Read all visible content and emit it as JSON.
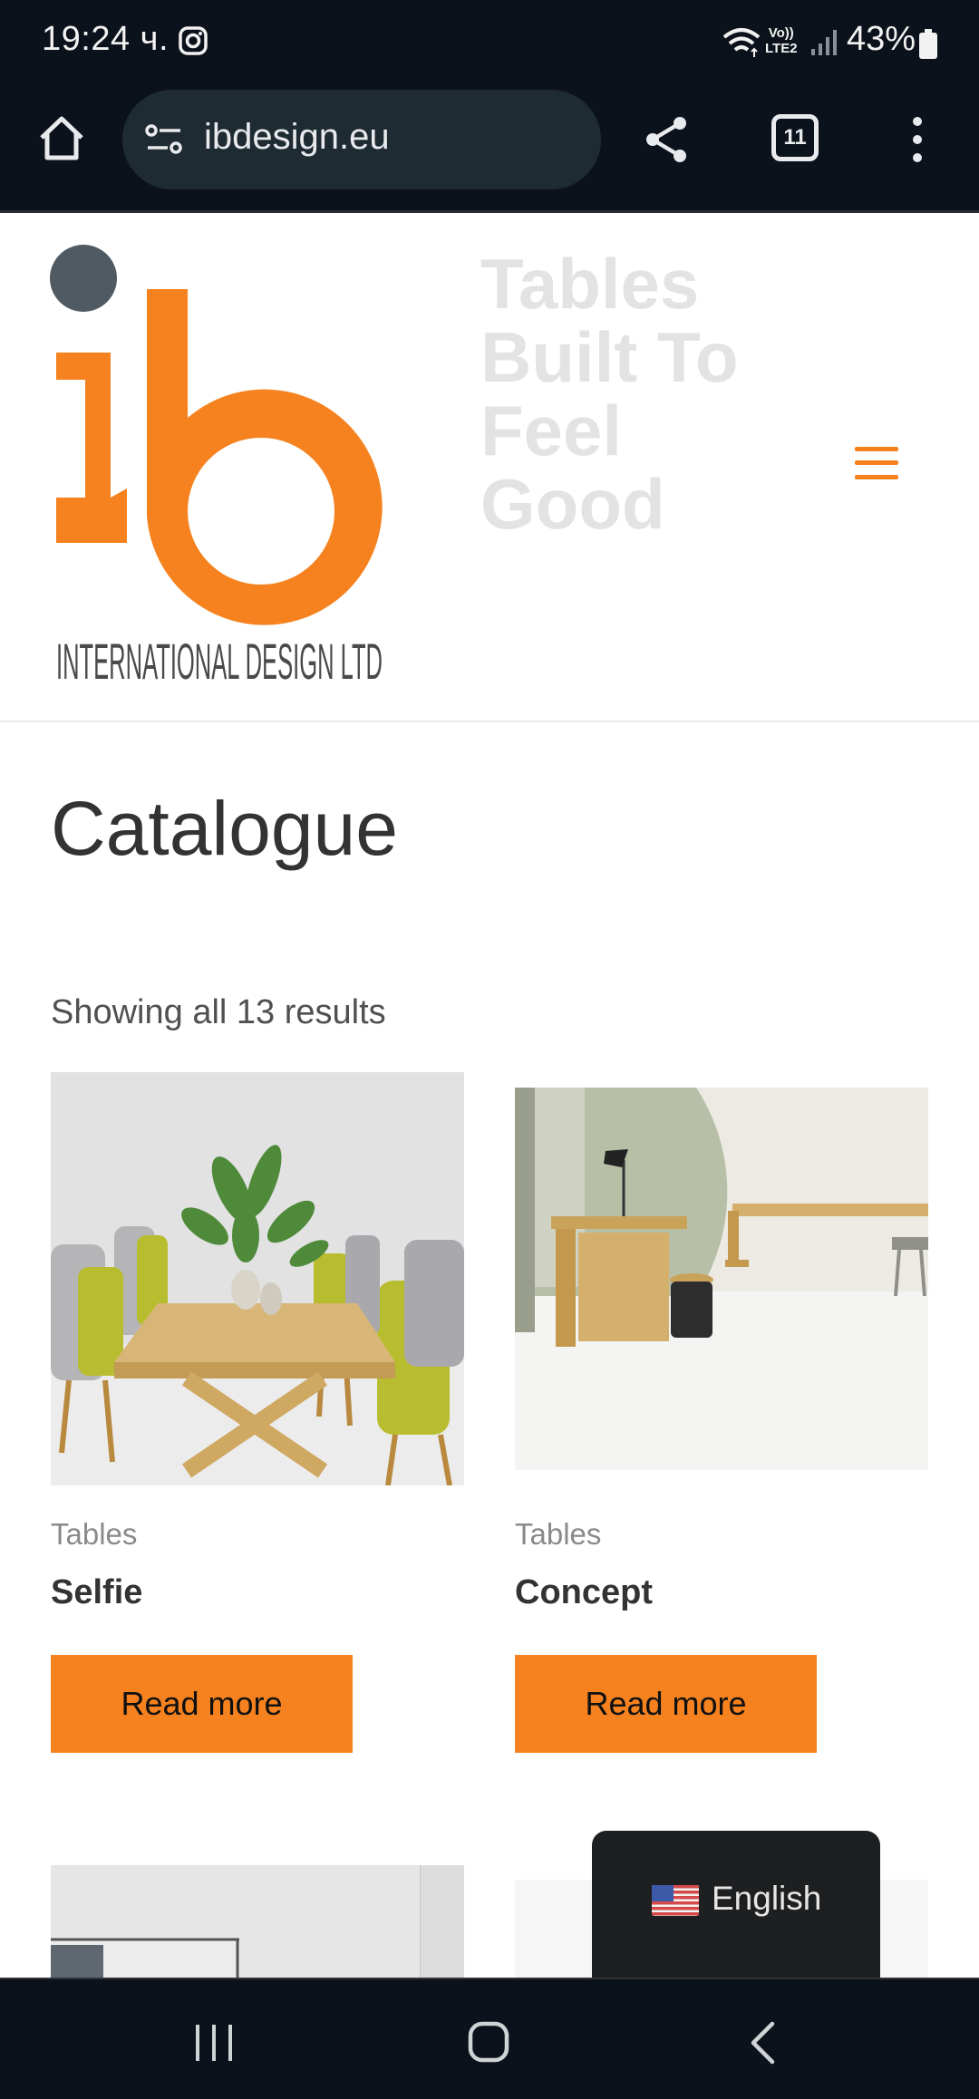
{
  "status_bar": {
    "time": "19:24 ч.",
    "network": [
      "Vo))",
      "LTE2"
    ],
    "battery": "43%"
  },
  "browser": {
    "url": "ibdesign.eu",
    "tab_count": "11"
  },
  "site": {
    "logo_text": "INTERNATIONAL DESIGN LTD",
    "tagline": "Tables Built To Feel Good",
    "brand_color": "#f5821f"
  },
  "page": {
    "title": "Catalogue",
    "result_count": "Showing all 13 results"
  },
  "products": [
    {
      "category": "Tables",
      "name": "Selfie",
      "button": "Read more"
    },
    {
      "category": "Tables",
      "name": "Concept",
      "button": "Read more"
    }
  ],
  "language": {
    "label": "English",
    "flag": "us-flag-icon"
  }
}
